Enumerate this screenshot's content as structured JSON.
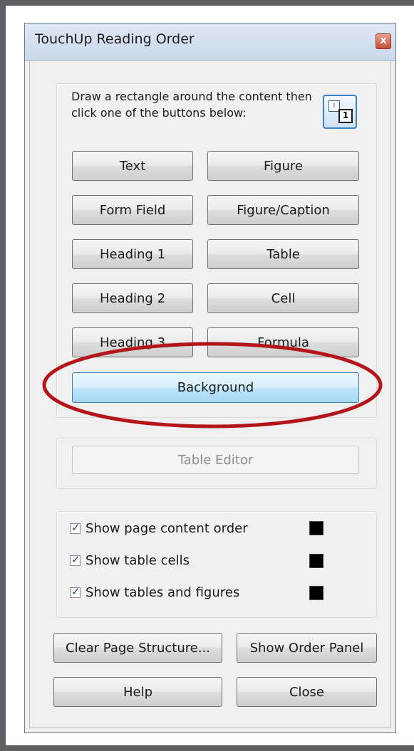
{
  "dialog": {
    "title": "TouchUp Reading Order",
    "close_glyph": "x"
  },
  "instructions": "Draw a rectangle around the content then click one of the buttons below:",
  "tool_icon": {
    "name": "reading-order-tool-icon",
    "glyph_a": "I",
    "glyph_b": "1"
  },
  "buttons": {
    "text": "Text",
    "figure": "Figure",
    "form_field": "Form Field",
    "figure_caption": "Figure/Caption",
    "heading1": "Heading 1",
    "table": "Table",
    "heading2": "Heading 2",
    "cell": "Cell",
    "heading3": "Heading 3",
    "formula": "Formula",
    "background": "Background",
    "table_editor": "Table Editor",
    "clear_page_structure": "Clear Page Structure...",
    "show_order_panel": "Show Order Panel",
    "help": "Help",
    "close": "Close"
  },
  "checkboxes": [
    {
      "label": "Show page content order",
      "checked": true,
      "color": "#000000"
    },
    {
      "label": "Show table cells",
      "checked": true,
      "color": "#000000"
    },
    {
      "label": "Show tables and figures",
      "checked": true,
      "color": "#000000"
    }
  ],
  "annotation": {
    "shape": "ellipse",
    "color": "#b3151b",
    "target": "Background"
  }
}
